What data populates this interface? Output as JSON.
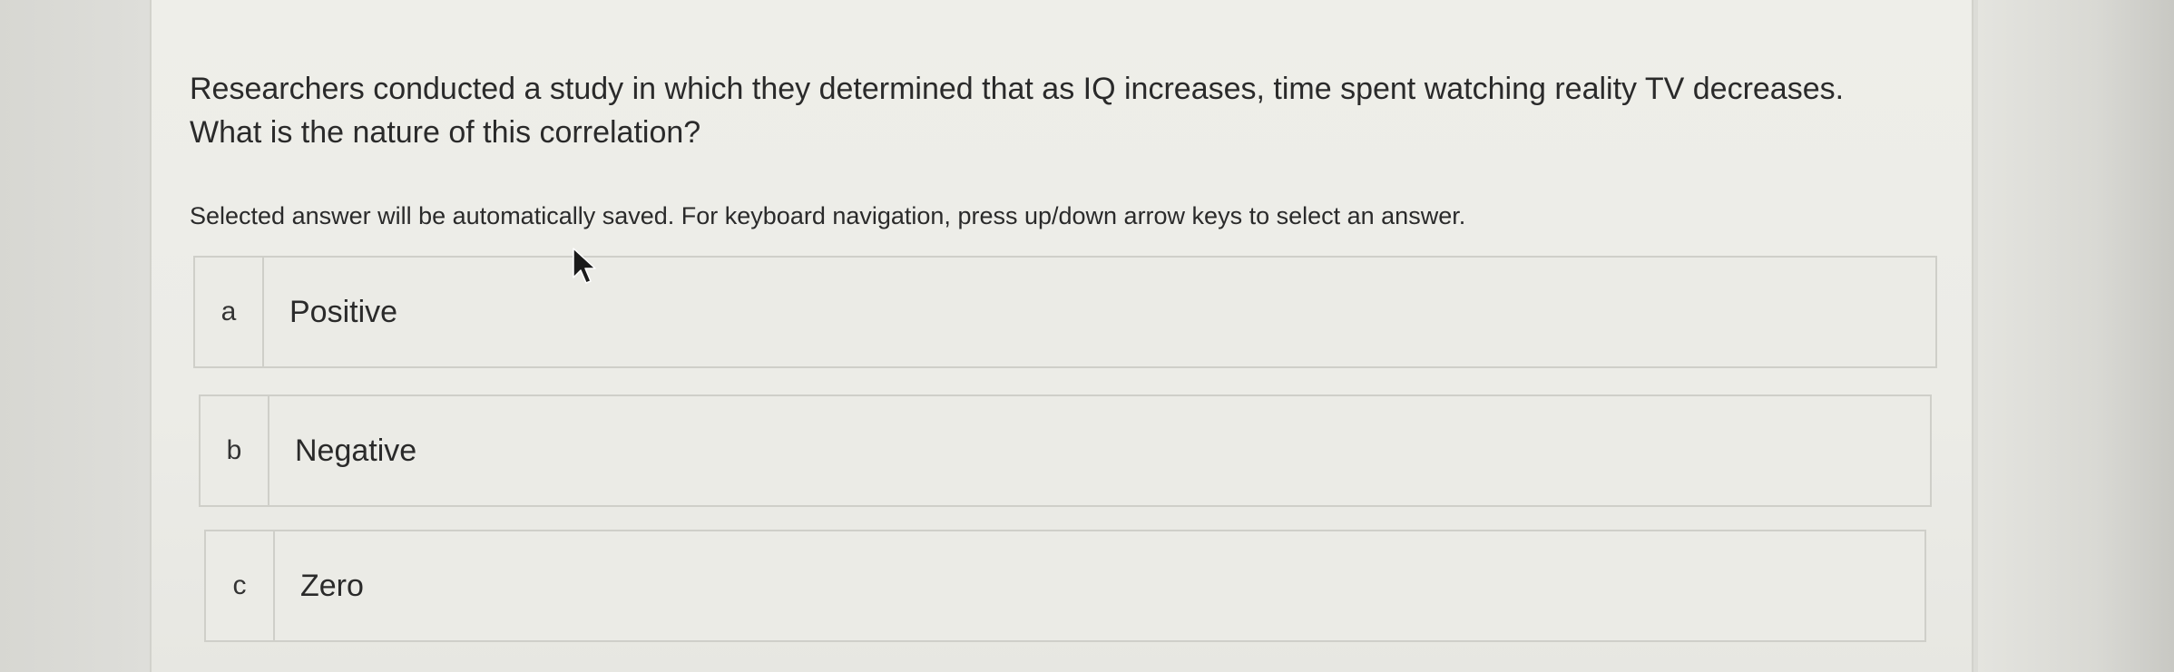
{
  "question": {
    "text": "Researchers conducted a study in which they determined that as IQ increases, time spent watching reality TV decreases. What is the nature of this correlation?"
  },
  "instructions": "Selected answer will be automatically saved. For keyboard navigation, press up/down arrow keys to select an answer.",
  "answers": [
    {
      "letter": "a",
      "label": "Positive"
    },
    {
      "letter": "b",
      "label": "Negative"
    },
    {
      "letter": "c",
      "label": "Zero"
    }
  ],
  "cursor": {
    "icon": "mouse-pointer-icon"
  }
}
